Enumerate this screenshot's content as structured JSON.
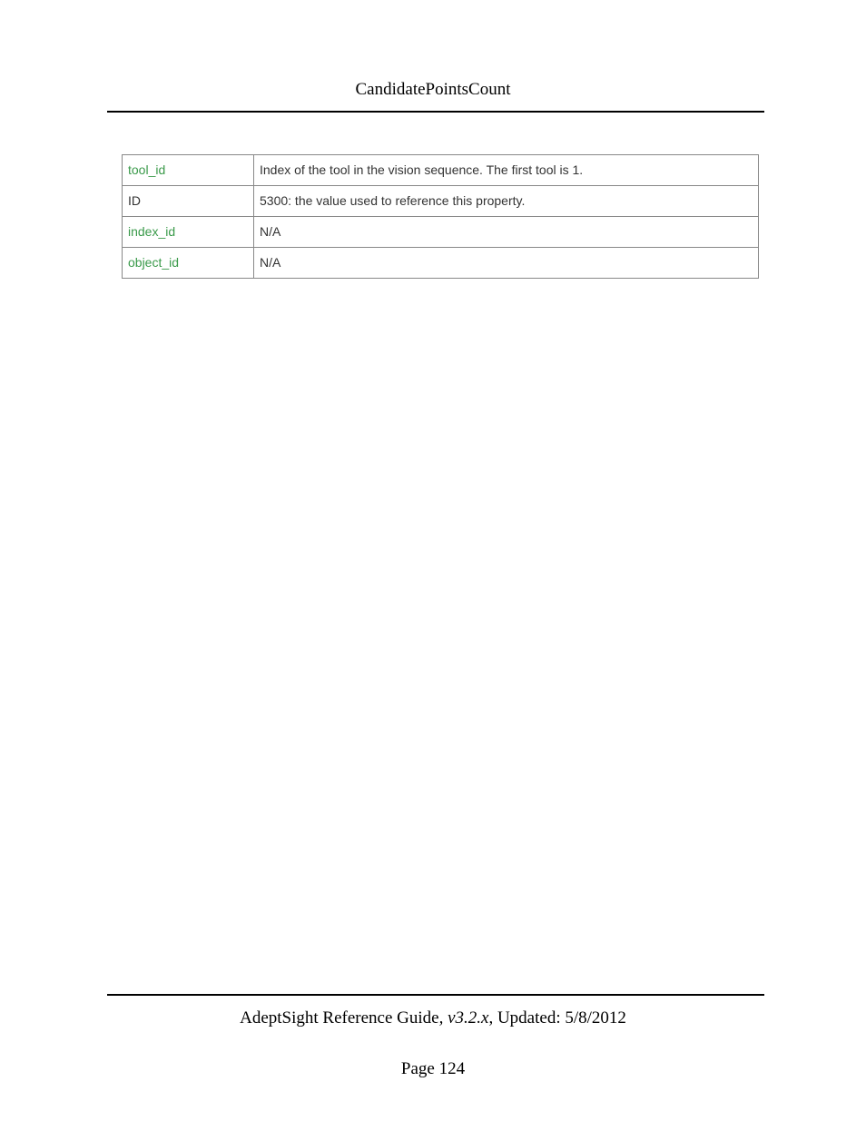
{
  "header": {
    "title": "CandidatePointsCount"
  },
  "table": {
    "rows": [
      {
        "name": "tool_id",
        "is_link": true,
        "desc": "Index of the tool in the vision sequence. The first tool is 1."
      },
      {
        "name": "ID",
        "is_link": false,
        "desc": "5300: the value used to reference this property."
      },
      {
        "name": "index_id",
        "is_link": true,
        "desc": "N/A"
      },
      {
        "name": "object_id",
        "is_link": true,
        "desc": "N/A"
      }
    ]
  },
  "footer": {
    "guide": "AdeptSight Reference Guide",
    "version": ", v3.2.x",
    "updated": ", Updated: 5/8/2012",
    "page_label": "Page 124"
  }
}
